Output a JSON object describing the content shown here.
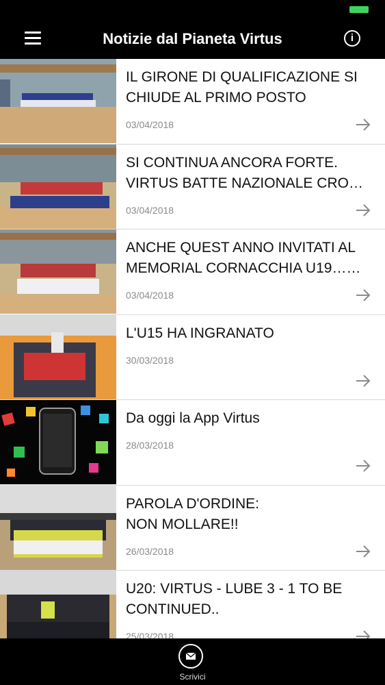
{
  "app": {
    "title": "Notizie dal Pianeta Virtus",
    "accent_color": "#3fd35e",
    "icons": {
      "menu": "hamburger-icon",
      "info": "info-icon",
      "item_arrow": "arrow-right-icon",
      "tab": "envelope-icon"
    }
  },
  "news": [
    {
      "title": "IL GIRONE DI QUALIFICAZIONE SI CHIUDE AL PRIMO POSTO",
      "date": "03/04/2018"
    },
    {
      "title": "SI CONTINUA ANCORA FORTE. VIRTUS BATTE NAZIONALE CRO…",
      "date": "03/04/2018"
    },
    {
      "title": "ANCHE QUEST ANNO INVITATI AL MEMORIAL CORNACCHIA U19……",
      "date": "03/04/2018"
    },
    {
      "title": "L'U15 HA INGRANATO",
      "date": "30/03/2018"
    },
    {
      "title": "Da oggi la App Virtus",
      "date": "28/03/2018"
    },
    {
      "title": "PAROLA D'ORDINE:\nNON MOLLARE!!",
      "date": "26/03/2018"
    },
    {
      "title": "U20: VIRTUS - LUBE 3 - 1 TO BE CONTINUED..",
      "date": "25/03/2018"
    }
  ],
  "tab_bar": {
    "label": "Scrivici"
  }
}
